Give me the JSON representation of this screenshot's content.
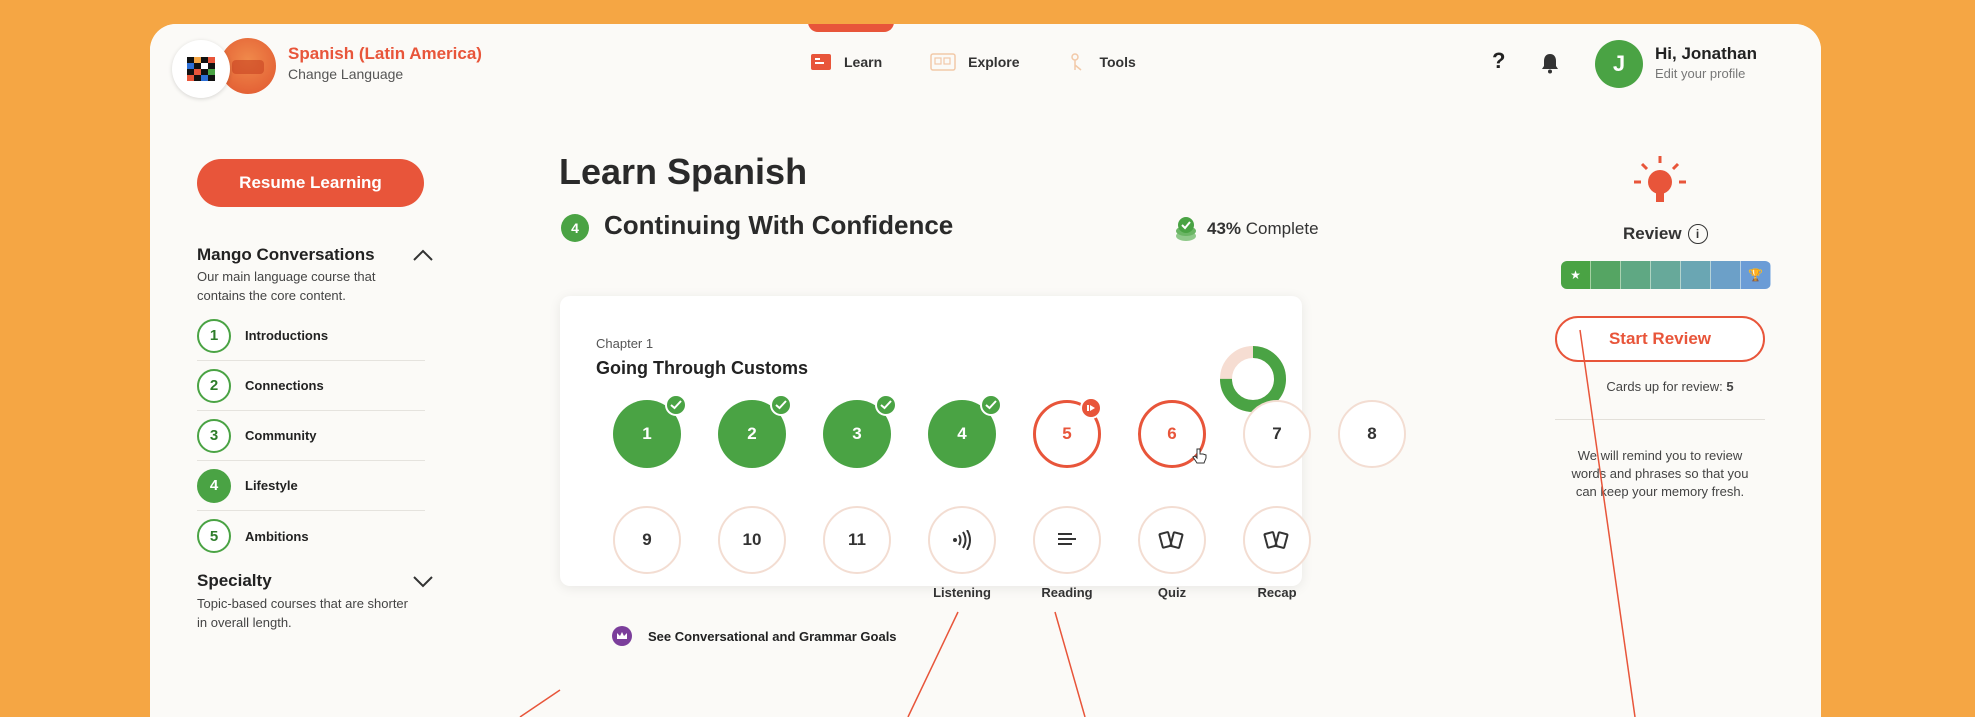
{
  "header": {
    "language_title": "Spanish (Latin America)",
    "language_subtitle": "Change Language",
    "nav": [
      {
        "label": "Learn",
        "icon": "learn-icon"
      },
      {
        "label": "Explore",
        "icon": "explore-icon"
      },
      {
        "label": "Tools",
        "icon": "tools-icon"
      }
    ],
    "help": "?",
    "avatar_initial": "J",
    "greeting": "Hi, Jonathan",
    "greeting_sub": "Edit your profile"
  },
  "sidebar": {
    "resume_label": "Resume Learning",
    "course_title": "Mango Conversations",
    "course_desc": "Our main language course that contains the core content.",
    "units": [
      {
        "num": "1",
        "label": "Introductions"
      },
      {
        "num": "2",
        "label": "Connections"
      },
      {
        "num": "3",
        "label": "Community"
      },
      {
        "num": "4",
        "label": "Lifestyle"
      },
      {
        "num": "5",
        "label": "Ambitions"
      }
    ],
    "specialty_title": "Specialty",
    "specialty_desc": "Topic-based courses that are shorter in overall length."
  },
  "main": {
    "title": "Learn Spanish",
    "unit_num": "4",
    "unit_title": "Continuing With Confidence",
    "complete_pct": "43%",
    "complete_label": "Complete",
    "chapter_label": "Chapter 1",
    "chapter_title": "Going Through Customs",
    "chapter_progress": 0.75,
    "lessons_row1": [
      "1",
      "2",
      "3",
      "4",
      "5",
      "6",
      "7",
      "8"
    ],
    "lessons_row2": [
      "9",
      "10",
      "11"
    ],
    "activities": [
      {
        "label": "Listening",
        "icon": "listening-icon"
      },
      {
        "label": "Reading",
        "icon": "reading-icon"
      },
      {
        "label": "Quiz",
        "icon": "cards-icon"
      },
      {
        "label": "Recap",
        "icon": "cards-icon"
      }
    ],
    "goals_label": "See Conversational and Grammar Goals"
  },
  "review": {
    "title": "Review",
    "start_label": "Start Review",
    "cards_label": "Cards up for review:",
    "cards_count": "5",
    "remind_text": "We will remind you to review words and phrases so that you can keep your memory fresh."
  },
  "colors": {
    "accent": "#e8553a",
    "green": "#4aa344",
    "background": "#f5a644"
  }
}
